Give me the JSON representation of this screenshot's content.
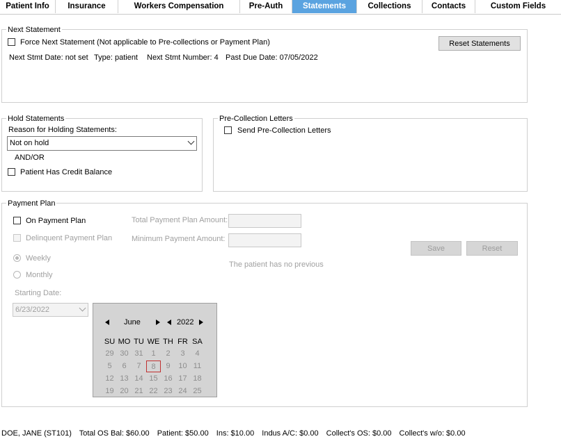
{
  "tabs": [
    {
      "label": "Patient Info",
      "active": false
    },
    {
      "label": "Insurance",
      "active": false
    },
    {
      "label": "Workers Compensation",
      "active": false
    },
    {
      "label": "Pre-Auth",
      "active": false
    },
    {
      "label": "Statements",
      "active": true
    },
    {
      "label": "Collections",
      "active": false
    },
    {
      "label": "Contacts",
      "active": false
    },
    {
      "label": "Custom Fields",
      "active": false
    }
  ],
  "next_statement": {
    "legend": "Next Statement",
    "force_label": "Force Next Statement (Not applicable to Pre-collections or Payment Plan)",
    "force_checked": false,
    "reset_button": "Reset Statements",
    "next_stmt_date": "Next Stmt Date: not set",
    "type": "Type: patient",
    "next_stmt_number": "Next Stmt Number: 4",
    "past_due_date": "Past Due Date: 07/05/2022"
  },
  "hold_statements": {
    "legend": "Hold Statements",
    "reason_label": "Reason for Holding Statements:",
    "reason_value": "Not on hold",
    "and_or": "AND/OR",
    "credit_label": "Patient Has Credit Balance",
    "credit_checked": false
  },
  "pre_collection": {
    "legend": "Pre-Collection Letters",
    "send_label": "Send Pre-Collection Letters",
    "send_checked": false
  },
  "payment_plan": {
    "legend": "Payment Plan",
    "on_plan_label": "On Payment Plan",
    "delinquent_label": "Delinquent Payment Plan",
    "weekly_label": "Weekly",
    "monthly_label": "Monthly",
    "selected_frequency": "Weekly",
    "starting_date_label": "Starting Date:",
    "starting_date_value": "6/23/2022",
    "total_amount_label": "Total Payment Plan Amount:",
    "total_amount_value": "",
    "minimum_amount_label": "Minimum Payment Amount:",
    "minimum_amount_value": "",
    "save_button": "Save",
    "reset_button": "Reset",
    "no_previous_text": "The patient has no previous"
  },
  "calendar": {
    "month": "June",
    "year": "2022",
    "day_headers": [
      "SU",
      "MO",
      "TU",
      "WE",
      "TH",
      "FR",
      "SA"
    ],
    "weeks": [
      [
        "29",
        "30",
        "31",
        "1",
        "2",
        "3",
        "4"
      ],
      [
        "5",
        "6",
        "7",
        "8",
        "9",
        "10",
        "11"
      ],
      [
        "12",
        "13",
        "14",
        "15",
        "16",
        "17",
        "18"
      ],
      [
        "19",
        "20",
        "21",
        "22",
        "23",
        "24",
        "25"
      ]
    ],
    "highlighted_day": "8"
  },
  "status_bar": {
    "patient": "DOE, JANE (ST101)",
    "total_os_bal": "Total OS Bal:  $60.00",
    "patient_bal": "Patient: $50.00",
    "ins": "Ins: $10.00",
    "indus": "Indus A/C: $0.00",
    "collect_os": "Collect's OS: $0.00",
    "collect_wo": "Collect's w/o: $0.00"
  },
  "colors": {
    "active_tab": "#5aa3e0",
    "highlight_border": "#c03030"
  }
}
